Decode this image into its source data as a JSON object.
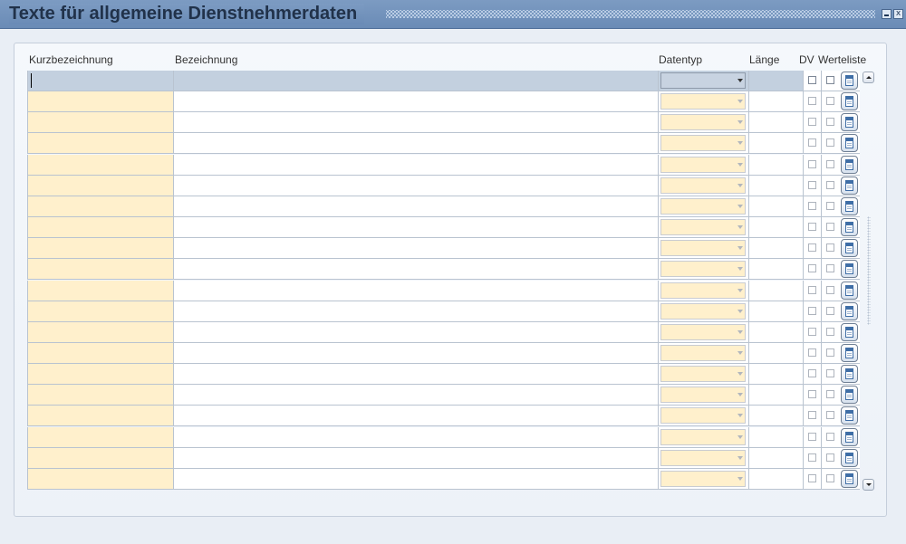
{
  "window": {
    "title": "Texte für allgemeine Dienstnehmerdaten",
    "minimize_icon": "minimize-icon",
    "close_icon": "close-icon",
    "close_glyph": "x"
  },
  "columns": {
    "kurzbezeichnung": "Kurzbezeichnung",
    "bezeichnung": "Bezeichnung",
    "datentyp": "Datentyp",
    "laenge": "Länge",
    "dv": "DV",
    "werteliste": "Werteliste"
  },
  "rows": [
    {
      "kurzbezeichnung": "",
      "bezeichnung": "",
      "datentyp": "",
      "laenge": "",
      "dv": false,
      "werteliste": false
    },
    {
      "kurzbezeichnung": "",
      "bezeichnung": "",
      "datentyp": "",
      "laenge": "",
      "dv": false,
      "werteliste": false
    },
    {
      "kurzbezeichnung": "",
      "bezeichnung": "",
      "datentyp": "",
      "laenge": "",
      "dv": false,
      "werteliste": false
    },
    {
      "kurzbezeichnung": "",
      "bezeichnung": "",
      "datentyp": "",
      "laenge": "",
      "dv": false,
      "werteliste": false
    },
    {
      "kurzbezeichnung": "",
      "bezeichnung": "",
      "datentyp": "",
      "laenge": "",
      "dv": false,
      "werteliste": false
    },
    {
      "kurzbezeichnung": "",
      "bezeichnung": "",
      "datentyp": "",
      "laenge": "",
      "dv": false,
      "werteliste": false
    },
    {
      "kurzbezeichnung": "",
      "bezeichnung": "",
      "datentyp": "",
      "laenge": "",
      "dv": false,
      "werteliste": false
    },
    {
      "kurzbezeichnung": "",
      "bezeichnung": "",
      "datentyp": "",
      "laenge": "",
      "dv": false,
      "werteliste": false
    },
    {
      "kurzbezeichnung": "",
      "bezeichnung": "",
      "datentyp": "",
      "laenge": "",
      "dv": false,
      "werteliste": false
    },
    {
      "kurzbezeichnung": "",
      "bezeichnung": "",
      "datentyp": "",
      "laenge": "",
      "dv": false,
      "werteliste": false
    },
    {
      "kurzbezeichnung": "",
      "bezeichnung": "",
      "datentyp": "",
      "laenge": "",
      "dv": false,
      "werteliste": false
    },
    {
      "kurzbezeichnung": "",
      "bezeichnung": "",
      "datentyp": "",
      "laenge": "",
      "dv": false,
      "werteliste": false
    },
    {
      "kurzbezeichnung": "",
      "bezeichnung": "",
      "datentyp": "",
      "laenge": "",
      "dv": false,
      "werteliste": false
    },
    {
      "kurzbezeichnung": "",
      "bezeichnung": "",
      "datentyp": "",
      "laenge": "",
      "dv": false,
      "werteliste": false
    },
    {
      "kurzbezeichnung": "",
      "bezeichnung": "",
      "datentyp": "",
      "laenge": "",
      "dv": false,
      "werteliste": false
    },
    {
      "kurzbezeichnung": "",
      "bezeichnung": "",
      "datentyp": "",
      "laenge": "",
      "dv": false,
      "werteliste": false
    },
    {
      "kurzbezeichnung": "",
      "bezeichnung": "",
      "datentyp": "",
      "laenge": "",
      "dv": false,
      "werteliste": false
    },
    {
      "kurzbezeichnung": "",
      "bezeichnung": "",
      "datentyp": "",
      "laenge": "",
      "dv": false,
      "werteliste": false
    },
    {
      "kurzbezeichnung": "",
      "bezeichnung": "",
      "datentyp": "",
      "laenge": "",
      "dv": false,
      "werteliste": false
    },
    {
      "kurzbezeichnung": "",
      "bezeichnung": "",
      "datentyp": "",
      "laenge": "",
      "dv": false,
      "werteliste": false
    }
  ],
  "row_button_icon": "list-of-values-icon",
  "scrollbar": {
    "up_icon": "scroll-up-icon",
    "down_icon": "scroll-down-icon"
  },
  "colors": {
    "title_bar": "#7c9bc2",
    "required_field": "#fff0cc",
    "current_row": "#c3d0df"
  }
}
